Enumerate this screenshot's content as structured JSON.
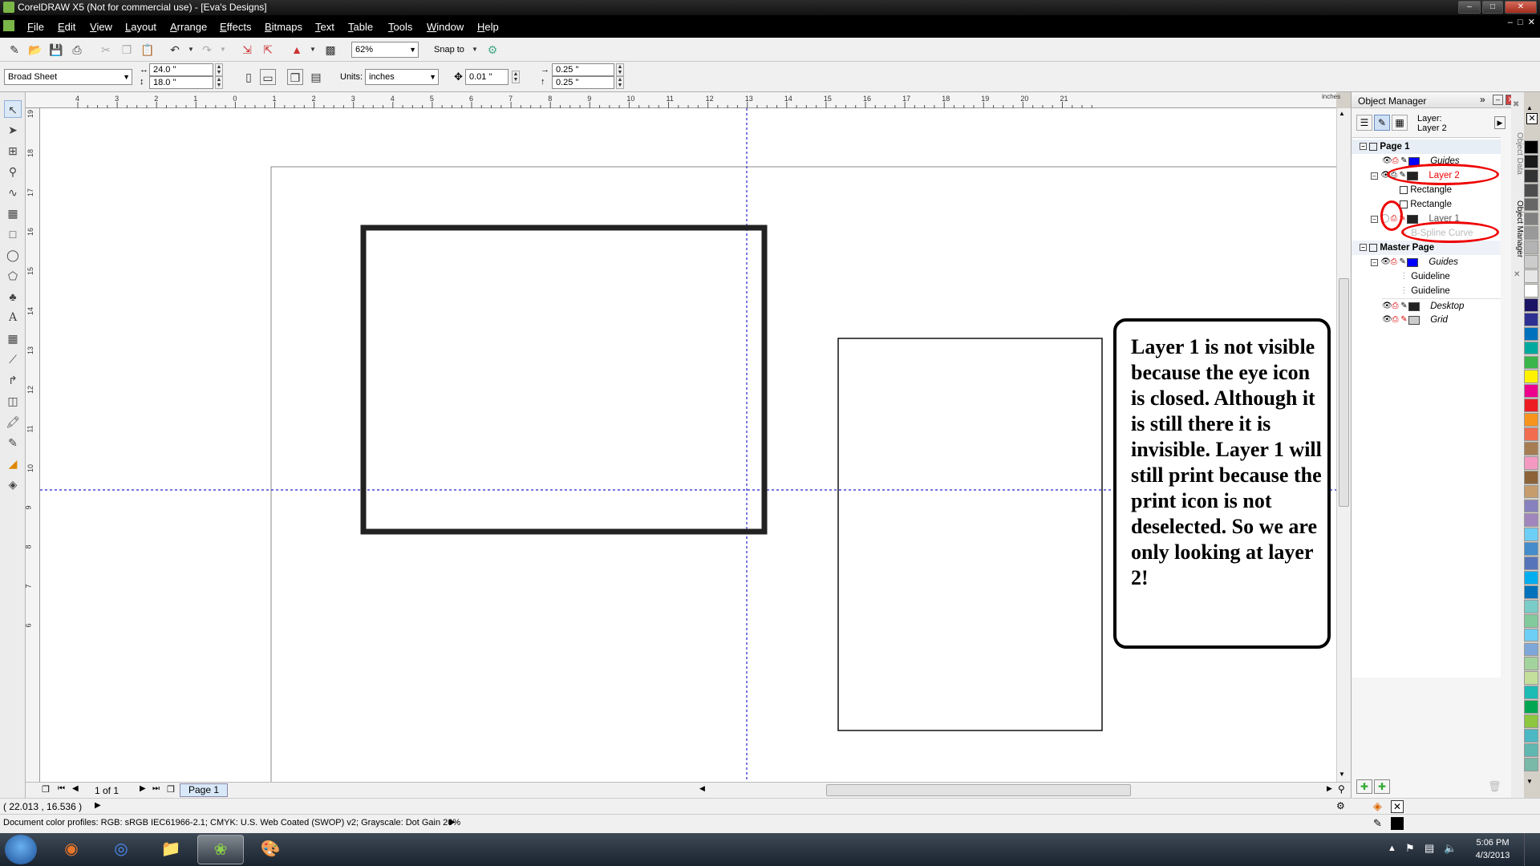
{
  "window": {
    "title": "CorelDRAW X5 (Not for commercial use) - [Eva's Designs]"
  },
  "menu": [
    "File",
    "Edit",
    "View",
    "Layout",
    "Arrange",
    "Effects",
    "Bitmaps",
    "Text",
    "Table",
    "Tools",
    "Window",
    "Help"
  ],
  "toolbar": {
    "zoom": "62%",
    "snap_to": "Snap to"
  },
  "propbar": {
    "page_preset": "Broad Sheet",
    "width": "24.0 \"",
    "height": "18.0 \"",
    "units_label": "Units:",
    "units": "inches",
    "nudge": "0.01 \"",
    "dup_x": "0.25 \"",
    "dup_y": "0.25 \""
  },
  "ruler": {
    "unit_label": "inches",
    "h_ticks": [
      "4",
      "3",
      "2",
      "1",
      "0",
      "1",
      "2",
      "3",
      "4",
      "5",
      "6",
      "7",
      "8",
      "9",
      "10",
      "11",
      "12",
      "13",
      "14",
      "15",
      "16",
      "17",
      "18",
      "19",
      "20",
      "21"
    ],
    "v_ticks": [
      "19",
      "18",
      "17",
      "16",
      "15",
      "14",
      "13",
      "12",
      "11",
      "10",
      "9",
      "8",
      "7",
      "6"
    ]
  },
  "callout": {
    "text": "Layer 1 is not visible because the eye icon is closed. Although it is still there it is invisible. Layer 1 will still print because the print icon is not deselected. So we are only looking at layer 2!"
  },
  "page_nav": {
    "counter": "1 of 1",
    "tab": "Page 1"
  },
  "status": {
    "coords": "( 22.013 , 16.536 )",
    "profiles": "Document color profiles: RGB: sRGB IEC61966-2.1; CMYK: U.S. Web Coated (SWOP) v2; Grayscale: Dot Gain 20%"
  },
  "docker": {
    "title": "Object Manager",
    "layer_label": "Layer:",
    "current_layer": "Layer 2",
    "tree": {
      "page1": "Page 1",
      "guides": "Guides",
      "layer2": "Layer 2",
      "rect1": "Rectangle",
      "rect2": "Rectangle",
      "layer1": "Layer 1",
      "bspline": "B-Spline Curve",
      "master": "Master Page",
      "m_guides": "Guides",
      "guideline1": "Guideline",
      "guideline2": "Guideline",
      "desktop": "Desktop",
      "grid": "Grid"
    },
    "side_tabs": [
      "Object Data",
      "Object Manager"
    ]
  },
  "palette_colors": [
    "#000000",
    "#1a1a1a",
    "#333333",
    "#4d4d4d",
    "#666666",
    "#808080",
    "#999999",
    "#b3b3b3",
    "#cccccc",
    "#e6e6e6",
    "#ffffff",
    "#1b1464",
    "#2e3192",
    "#0071bc",
    "#00a99d",
    "#39b54a",
    "#fff200",
    "#ec008c",
    "#ed1c24",
    "#f7941d",
    "#f26c4f",
    "#a67c52",
    "#f49ac2",
    "#8c6239",
    "#c69c6d",
    "#8781bd",
    "#a186be",
    "#6dcff6",
    "#448ccb",
    "#5674b9",
    "#00aeef",
    "#0072bc",
    "#7accc8",
    "#82ca9c",
    "#6dcff6",
    "#7da7d9",
    "#a3d39c",
    "#c4df9b",
    "#1cbbb4",
    "#00a651",
    "#8dc63f",
    "#4cb8c4",
    "#5fb7b0",
    "#78b9a8"
  ],
  "taskbar": {
    "time": "5:06 PM",
    "date": "4/3/2013"
  }
}
